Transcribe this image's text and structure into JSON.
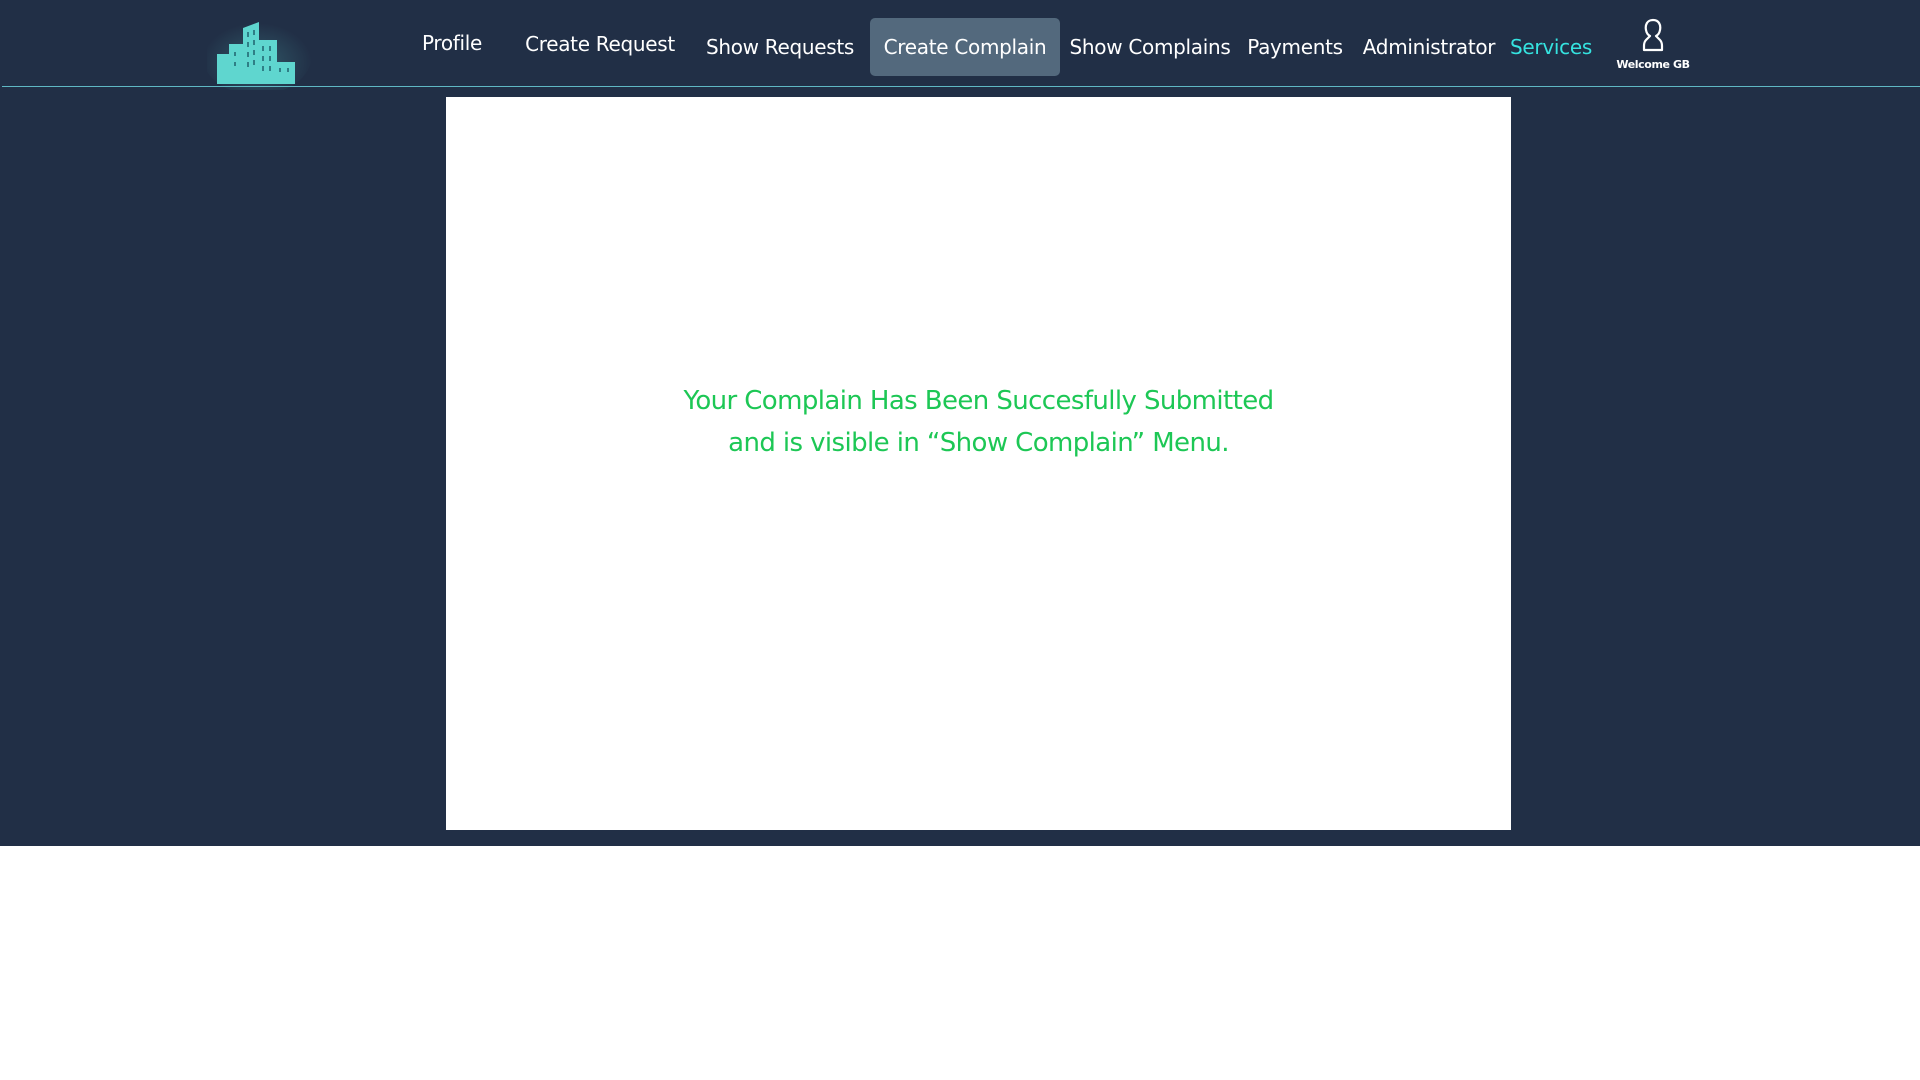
{
  "nav": {
    "items": [
      {
        "label": "Profile"
      },
      {
        "label": "Create Request"
      },
      {
        "label": "Show Requests"
      },
      {
        "label": "Create Complain",
        "active": true
      },
      {
        "label": "Show Complains"
      },
      {
        "label": "Payments"
      },
      {
        "label": "Administrator"
      },
      {
        "label": "Services",
        "highlight": true
      }
    ],
    "user_label": "Welcome GB"
  },
  "message": {
    "line1": "Your Complain Has Been Succesfully Submitted",
    "line2": "and is visible in “Show Complain” Menu."
  },
  "colors": {
    "background": "#212f46",
    "active_tab": "#53697d",
    "accent": "#35e3e0",
    "logo": "#5fd6cf",
    "success_text": "#1dc755",
    "panel": "#ffffff"
  },
  "icons": {
    "logo": "buildings-logo-icon",
    "user": "user-icon"
  }
}
